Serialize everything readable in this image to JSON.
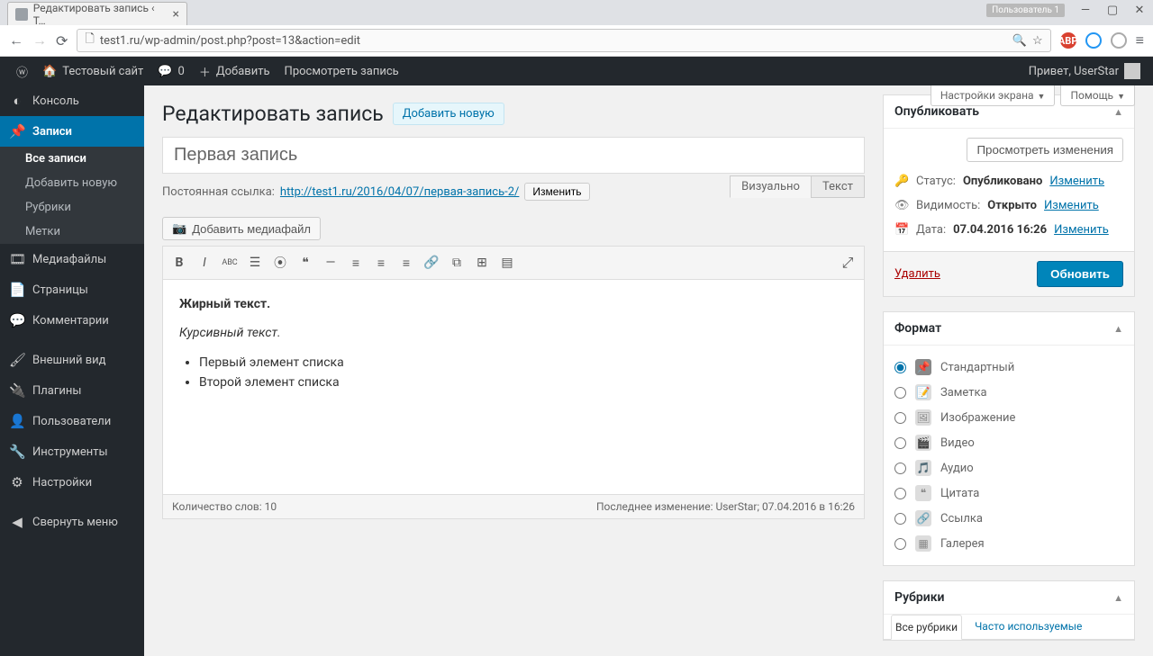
{
  "browser": {
    "tab_title": "Редактировать запись ‹ Т…",
    "user_profile_label": "Пользователь 1",
    "url": "test1.ru/wp-admin/post.php?post=13&action=edit"
  },
  "adminbar": {
    "site_name": "Тестовый сайт",
    "comments_count": "0",
    "add_new": "Добавить",
    "view_post": "Просмотреть запись",
    "greeting": "Привет, UserStar"
  },
  "menu": {
    "dashboard": "Консоль",
    "posts": "Записи",
    "posts_sub": {
      "all": "Все записи",
      "add": "Добавить новую",
      "categories": "Рубрики",
      "tags": "Метки"
    },
    "media": "Медиафайлы",
    "pages": "Страницы",
    "comments": "Комментарии",
    "appearance": "Внешний вид",
    "plugins": "Плагины",
    "users": "Пользователи",
    "tools": "Инструменты",
    "settings": "Настройки",
    "collapse": "Свернуть меню"
  },
  "screen": {
    "options": "Настройки экрана",
    "help": "Помощь"
  },
  "page": {
    "title": "Редактировать запись",
    "add_new": "Добавить новую",
    "post_title": "Первая запись",
    "permalink_label": "Постоянная ссылка:",
    "permalink_url": "http://test1.ru/2016/04/07/первая-запись-2/",
    "edit_btn": "Изменить",
    "media_btn": "Добавить медиафайл",
    "tabs": {
      "visual": "Визуально",
      "text": "Текст"
    },
    "content": {
      "bold_line": "Жирный текст.",
      "italic_line": "Курсивный текст.",
      "li1": "Первый элемент списка",
      "li2": "Второй элемент списка"
    },
    "word_count": "Количество слов: 10",
    "last_edit": "Последнее изменение: UserStar; 07.04.2016 в 16:26"
  },
  "publish": {
    "box_title": "Опубликовать",
    "preview_btn": "Просмотреть изменения",
    "status_label": "Статус:",
    "status_value": "Опубликовано",
    "visibility_label": "Видимость:",
    "visibility_value": "Открыто",
    "date_label": "Дата:",
    "date_value": "07.04.2016 16:26",
    "edit_link": "Изменить",
    "delete": "Удалить",
    "update": "Обновить"
  },
  "format": {
    "box_title": "Формат",
    "options": [
      "Стандартный",
      "Заметка",
      "Изображение",
      "Видео",
      "Аудио",
      "Цитата",
      "Ссылка",
      "Галерея"
    ]
  },
  "categories": {
    "box_title": "Рубрики",
    "tab_all": "Все рубрики",
    "tab_used": "Часто используемые"
  }
}
